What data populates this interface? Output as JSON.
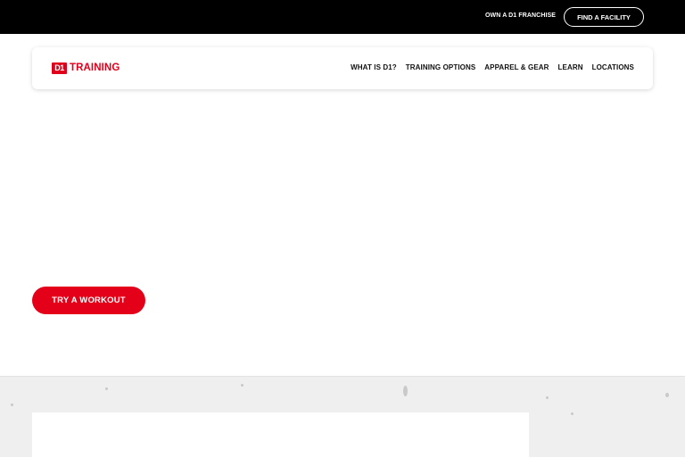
{
  "topbar": {
    "franchise_label": "OWN A D1 FRANCHISE",
    "find_label": "FIND A FACILITY"
  },
  "header": {
    "logo_mark": "D1",
    "logo_text": "TRAINING",
    "nav": [
      {
        "label": "WHAT IS D1?"
      },
      {
        "label": "TRAINING OPTIONS"
      },
      {
        "label": "APPAREL & GEAR"
      },
      {
        "label": "LEARN"
      },
      {
        "label": "LOCATIONS"
      }
    ]
  },
  "hero": {
    "cta_label": "TRY A WORKOUT"
  },
  "colors": {
    "brand_red": "#e0001b",
    "topbar_bg": "#000000",
    "section_bg": "#efefef"
  }
}
